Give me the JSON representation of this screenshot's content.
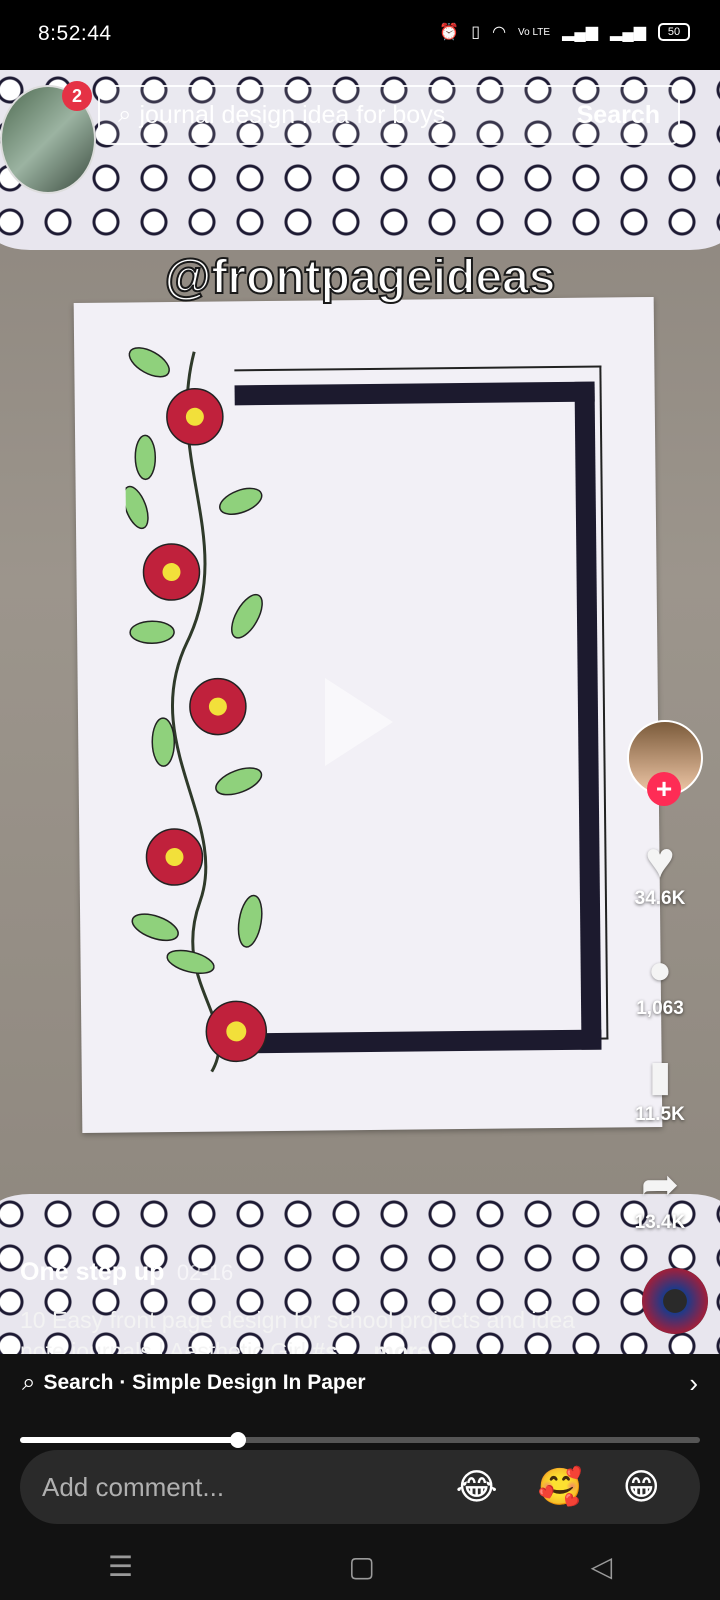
{
  "status_bar": {
    "time": "8:52:44",
    "icons": [
      "alarm-icon",
      "vibrate-icon",
      "wifi-icon",
      "volte-icon",
      "signal-icon",
      "signal-icon",
      "battery-icon"
    ],
    "volte_label": "Vo LTE",
    "battery": "50"
  },
  "top_bar": {
    "notification_count": "2",
    "search_query": "journal design idea for boys",
    "search_button": "Search"
  },
  "video": {
    "watermark": "@frontpageideas",
    "playing": false
  },
  "actions": {
    "likes": "34.6K",
    "comments": "1,063",
    "saves": "11.5K",
    "shares": "13.4K",
    "follow_symbol": "+"
  },
  "caption": {
    "author": "One step up",
    "date": "02-16",
    "description": "10 Easy front page design for school projects and idea note journals | Aesthetic Girl",
    "hashtag": "#s...",
    "more": "more"
  },
  "suggestion": {
    "label": "Search · Simple Design In Paper"
  },
  "playback": {
    "progress": 0.32
  },
  "comment_bar": {
    "placeholder": "Add comment...",
    "emojis": [
      "😂",
      "🥰",
      "😁"
    ]
  },
  "nav": {
    "menu": "☰",
    "home": "▢",
    "back": "◁"
  },
  "colors": {
    "like": "#f4f4f4",
    "follow": "#fe2c55",
    "badge": "#e53245"
  }
}
